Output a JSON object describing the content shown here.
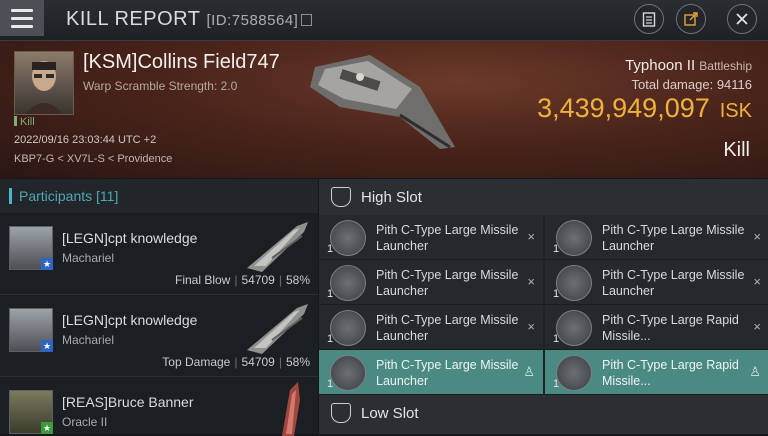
{
  "header": {
    "title": "KILL REPORT",
    "report_id": "[ID:7588564]"
  },
  "victim": {
    "name": "[KSM]Collins Field747",
    "subtitle": "Warp Scramble Strength: 2.0",
    "kill_tag": "Kill",
    "datetime": "2022/09/16 23:03:44 UTC +2",
    "location": "KBP7-G < XV7L-S < Providence",
    "ship_name": "Typhoon II",
    "ship_class": "Battleship",
    "total_damage_label": "Total damage:",
    "total_damage": "94116",
    "isk_value": "3,439,949,097",
    "isk_unit": "ISK",
    "kill_label": "Kill"
  },
  "participants": {
    "label": "Participants",
    "count": "[11]",
    "rows": [
      {
        "name": "[LEGN]cpt knowledge",
        "ship": "Machariel",
        "tag": "Final Blow",
        "damage": "54709",
        "percent": "58%"
      },
      {
        "name": "[LEGN]cpt knowledge",
        "ship": "Machariel",
        "tag": "Top Damage",
        "damage": "54709",
        "percent": "58%"
      },
      {
        "name": "[REAS]Bruce Banner",
        "ship": "Oracle II",
        "tag": "",
        "damage": "",
        "percent": ""
      }
    ]
  },
  "slots": {
    "high_label": "High Slot",
    "low_label": "Low Slot",
    "high_modules": [
      {
        "name": "Pith C-Type Large Missile Launcher",
        "qty": "1",
        "action": "×"
      },
      {
        "name": "Pith C-Type Large Missile Launcher",
        "qty": "1",
        "action": "×"
      },
      {
        "name": "Pith C-Type Large Missile Launcher",
        "qty": "1",
        "action": "×"
      },
      {
        "name": "Pith C-Type Large Missile Launcher",
        "qty": "1",
        "action": "×"
      },
      {
        "name": "Pith C-Type Large Missile Launcher",
        "qty": "1",
        "action": "×"
      },
      {
        "name": "Pith C-Type Large Rapid Missile...",
        "qty": "1",
        "action": "×"
      },
      {
        "name": "Pith C-Type Large Missile Launcher",
        "qty": "1",
        "action": "♙"
      },
      {
        "name": "Pith C-Type Large Rapid Missile...",
        "qty": "1",
        "action": "♙"
      }
    ]
  },
  "colors": {
    "accent": "#4fa7b4",
    "isk": "#f0b23a",
    "highlight_row": "#4b8a83"
  }
}
